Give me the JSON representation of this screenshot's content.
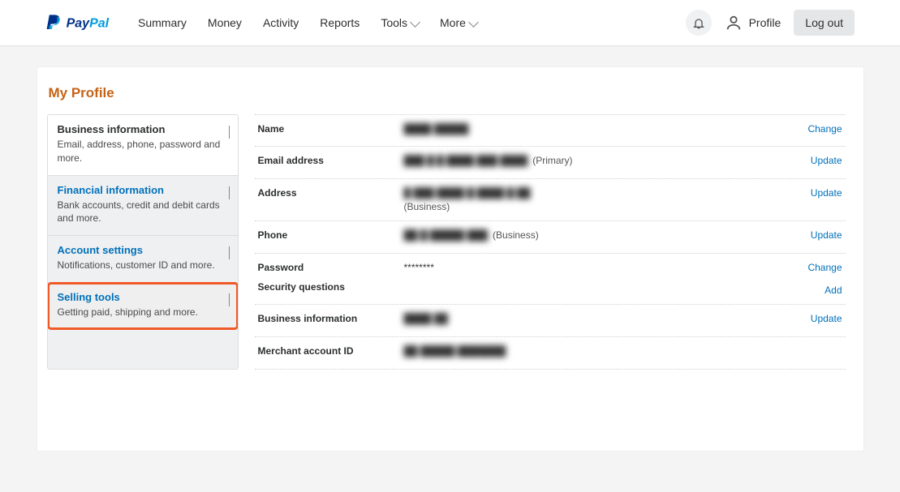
{
  "header": {
    "nav": [
      "Summary",
      "Money",
      "Activity",
      "Reports",
      "Tools",
      "More"
    ],
    "profile_label": "Profile",
    "logout_label": "Log out"
  },
  "page": {
    "title": "My Profile"
  },
  "sidebar": {
    "items": [
      {
        "title": "Business information",
        "desc": "Email, address, phone, password and more.",
        "active": true
      },
      {
        "title": "Financial information",
        "desc": "Bank accounts, credit and debit cards and more.",
        "link": true
      },
      {
        "title": "Account settings",
        "desc": "Notifications, customer ID and more.",
        "link": true
      },
      {
        "title": "Selling tools",
        "desc": "Getting paid, shipping and more.",
        "link": true,
        "highlighted": true
      }
    ]
  },
  "details": {
    "rows": [
      {
        "label": "Name",
        "redacted": "████  █████",
        "suffix": "",
        "actions": [
          "Change"
        ]
      },
      {
        "label": "Email address",
        "redacted": "███ █ █ ████  ███ ████",
        "suffix": "(Primary)",
        "actions": [
          "Update"
        ]
      },
      {
        "label": "Address",
        "redacted": "█ ███  ████  █ ████ █  ██",
        "suffix": "",
        "sub": "(Business)",
        "actions": [
          "Update"
        ]
      },
      {
        "label": "Phone",
        "redacted": "██ █ █████ ███",
        "suffix": "(Business)",
        "actions": [
          "Update"
        ]
      },
      {
        "label": "Password",
        "value": "********",
        "actions": [
          "Change"
        ],
        "subrow": {
          "label": "Security questions",
          "actions": [
            "Add"
          ]
        }
      },
      {
        "label": "Business information",
        "redacted": "████  ██",
        "actions": [
          "Update"
        ]
      },
      {
        "label": "Merchant account ID",
        "redacted": "██   █████ ███████",
        "actions": []
      }
    ]
  }
}
